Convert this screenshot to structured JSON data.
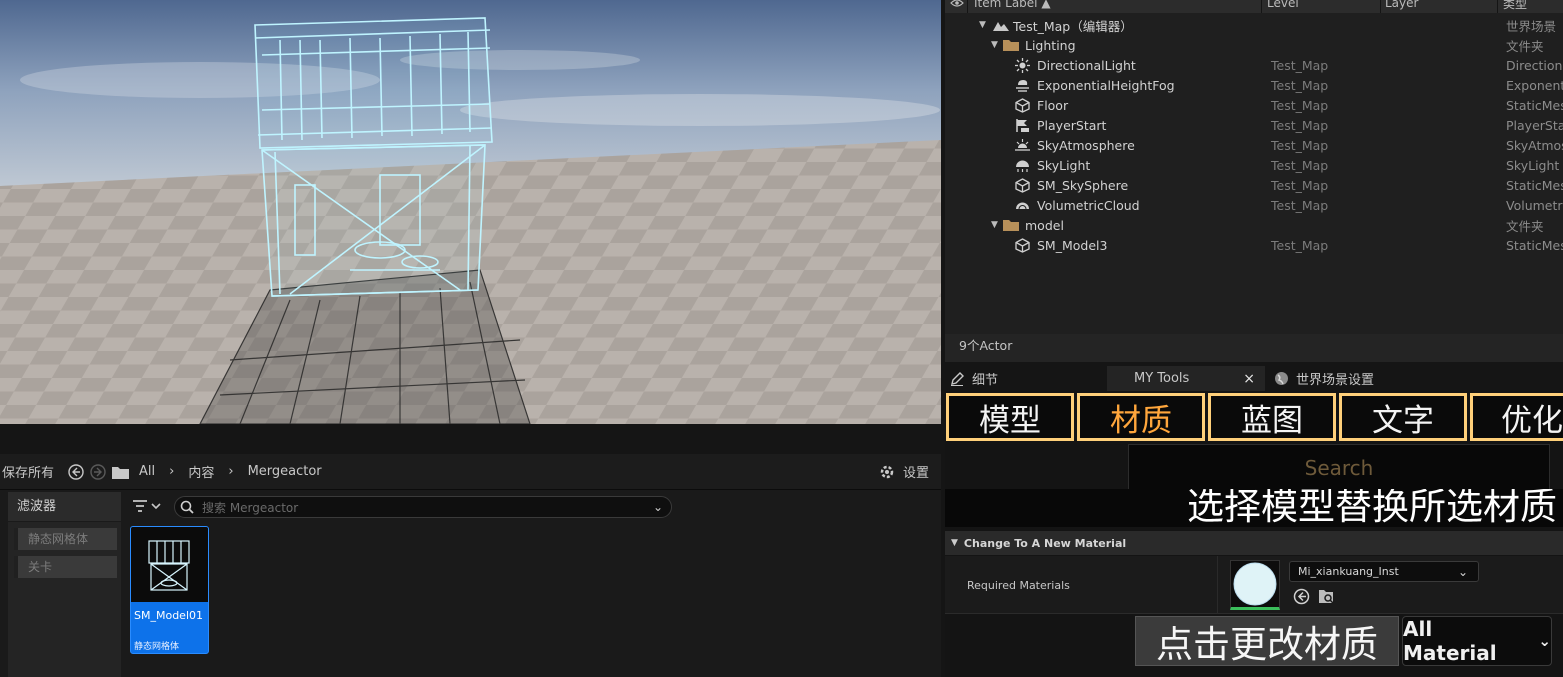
{
  "colors": {
    "accent": "#ffd07a",
    "active_category": "#ffa63c",
    "selection_blue": "#0d72ea",
    "panel_bg": "#1f1f1f"
  },
  "content_browser": {
    "save_all": "保存所有",
    "path": [
      "All",
      "内容",
      "Mergeactor"
    ],
    "settings": "设置",
    "filters_title": "滤波器",
    "filter_chips": [
      "静态网格体",
      "关卡"
    ],
    "search_placeholder": "搜索 Mergeactor",
    "asset": {
      "name": "SM_Model01",
      "type": "静态网格体"
    }
  },
  "outliner": {
    "columns": {
      "label": "Item Label ▲",
      "level": "Level",
      "layer": "Layer",
      "type": "类型"
    },
    "rows": [
      {
        "label": "Test_Map（编辑器）",
        "level": "",
        "type": "世界场景",
        "icon": "map-icon"
      },
      {
        "label": "Lighting",
        "level": "",
        "type": "文件夹",
        "icon": "folder-icon"
      },
      {
        "label": "DirectionalLight",
        "level": "Test_Map",
        "type": "Directiona",
        "icon": "sun-icon"
      },
      {
        "label": "ExponentialHeightFog",
        "level": "Test_Map",
        "type": "Exponenti",
        "icon": "fog-icon"
      },
      {
        "label": "Floor",
        "level": "Test_Map",
        "type": "StaticMes",
        "icon": "mesh-icon"
      },
      {
        "label": "PlayerStart",
        "level": "Test_Map",
        "type": "PlayerSta",
        "icon": "player-start-icon"
      },
      {
        "label": "SkyAtmosphere",
        "level": "Test_Map",
        "type": "SkyAtmos",
        "icon": "sky-atmosphere-icon"
      },
      {
        "label": "SkyLight",
        "level": "Test_Map",
        "type": "SkyLight",
        "icon": "skylight-icon"
      },
      {
        "label": "SM_SkySphere",
        "level": "Test_Map",
        "type": "StaticMes",
        "icon": "mesh-icon"
      },
      {
        "label": "VolumetricCloud",
        "level": "Test_Map",
        "type": "Volumetric",
        "icon": "cloud-icon"
      },
      {
        "label": "model",
        "level": "",
        "type": "文件夹",
        "icon": "folder-icon"
      },
      {
        "label": "SM_Model3",
        "level": "Test_Map",
        "type": "StaticMes",
        "icon": "mesh-icon"
      }
    ],
    "status": "9个Actor"
  },
  "tabs": {
    "details": "细节",
    "my_tools": "MY Tools",
    "world_settings": "世界场景设置"
  },
  "my_tools": {
    "categories": [
      "模型",
      "材质",
      "蓝图",
      "文字",
      "优化"
    ],
    "active_category": "材质",
    "search": "Search",
    "hint": "选择模型替换所选材质",
    "section": "Change To A New Material",
    "required_label": "Required Materials",
    "material": "Mi_xiankuang_Inst",
    "apply_button": "点击更改材质",
    "filter": "All Material"
  }
}
